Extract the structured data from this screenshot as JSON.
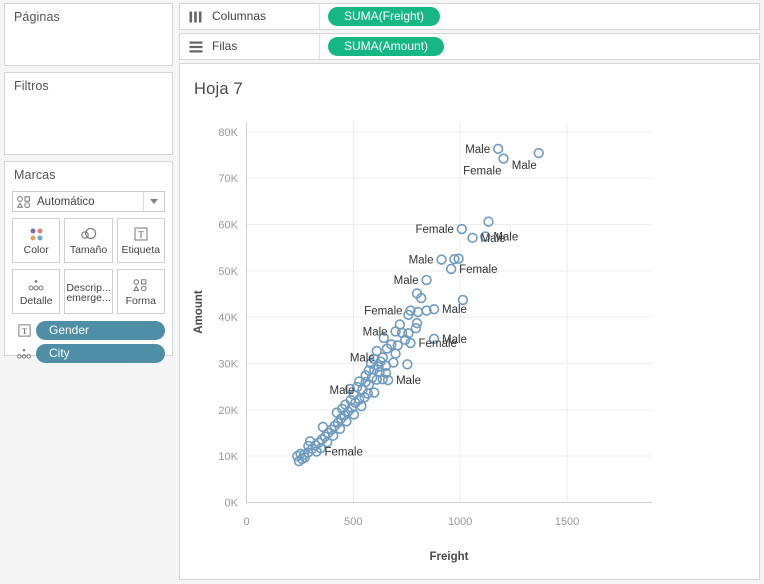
{
  "sidebar": {
    "pages": {
      "title": "Páginas"
    },
    "filters": {
      "title": "Filtros"
    },
    "marks": {
      "title": "Marcas",
      "mark_type": "Automático",
      "buttons": [
        {
          "label": "Color",
          "icon": "color-dots-icon"
        },
        {
          "label": "Tamaño",
          "icon": "size-circles-icon"
        },
        {
          "label": "Etiqueta",
          "icon": "label-t-icon"
        },
        {
          "label": "Detalle",
          "icon": "detail-dots-icon"
        },
        {
          "label": "Descrip... emerge...",
          "label_line1": "Descrip...",
          "label_line2": "emerge...",
          "icon": "tooltip-icon"
        },
        {
          "label": "Forma",
          "icon": "shape-icon"
        }
      ],
      "shelf_pills": [
        {
          "label": "Gender",
          "icon": "label-t-icon"
        },
        {
          "label": "City",
          "icon": "detail-dots-icon"
        }
      ]
    }
  },
  "shelves": [
    {
      "name": "Columnas",
      "icon": "columns-icon",
      "pill": "SUMA(Freight)"
    },
    {
      "name": "Filas",
      "icon": "rows-icon",
      "pill": "SUMA(Amount)"
    }
  ],
  "worksheet": {
    "title": "Hoja 7"
  },
  "colors": {
    "pill_green": "#16b783",
    "pill_blue": "#4e8fa6",
    "mark_stroke": "#6f9bc0",
    "gridline": "#eeeeee",
    "panel_bg": "#f5f5f5"
  },
  "chart_data": {
    "type": "scatter",
    "title": "Hoja 7",
    "xlabel": "Freight",
    "ylabel": "Amount",
    "xlim": [
      0,
      1900
    ],
    "ylim": [
      0,
      82000
    ],
    "xticks": [
      0,
      500,
      1000,
      1500
    ],
    "xticklabels": [
      "0",
      "500",
      "1000",
      "1500"
    ],
    "yticks": [
      0,
      10000,
      20000,
      30000,
      40000,
      50000,
      60000,
      70000,
      80000
    ],
    "yticklabels": [
      "0K",
      "10K",
      "20K",
      "30K",
      "40K",
      "50K",
      "60K",
      "70K",
      "80K"
    ],
    "grid": true,
    "legend": null,
    "marker": "open-circle",
    "label_field": "Gender",
    "detail_field": "City",
    "points": [
      {
        "x": 1180,
        "y": 76200,
        "label": "Male",
        "label_pos": "left"
      },
      {
        "x": 1205,
        "y": 74100,
        "label": "Female",
        "label_pos": "below"
      },
      {
        "x": 1370,
        "y": 75300,
        "label": "Male",
        "label_pos": "below"
      },
      {
        "x": 1135,
        "y": 60500,
        "label": "",
        "label_pos": "none"
      },
      {
        "x": 1010,
        "y": 58900,
        "label": "Female",
        "label_pos": "left"
      },
      {
        "x": 1060,
        "y": 57000,
        "label": "Male",
        "label_pos": "right"
      },
      {
        "x": 1120,
        "y": 57300,
        "label": "Male",
        "label_pos": "right"
      },
      {
        "x": 915,
        "y": 52300,
        "label": "Male",
        "label_pos": "left"
      },
      {
        "x": 975,
        "y": 52400,
        "label": "",
        "label_pos": "none"
      },
      {
        "x": 995,
        "y": 52500,
        "label": "",
        "label_pos": "none"
      },
      {
        "x": 960,
        "y": 50300,
        "label": "Female",
        "label_pos": "right"
      },
      {
        "x": 845,
        "y": 47900,
        "label": "Male",
        "label_pos": "left"
      },
      {
        "x": 800,
        "y": 45000,
        "label": "",
        "label_pos": "none"
      },
      {
        "x": 820,
        "y": 44000,
        "label": "",
        "label_pos": "none"
      },
      {
        "x": 1015,
        "y": 43600,
        "label": "",
        "label_pos": "none"
      },
      {
        "x": 880,
        "y": 41600,
        "label": "Male",
        "label_pos": "right"
      },
      {
        "x": 845,
        "y": 41300,
        "label": "",
        "label_pos": "none"
      },
      {
        "x": 805,
        "y": 41000,
        "label": "",
        "label_pos": "none"
      },
      {
        "x": 770,
        "y": 41300,
        "label": "Female",
        "label_pos": "left"
      },
      {
        "x": 800,
        "y": 38600,
        "label": "",
        "label_pos": "none"
      },
      {
        "x": 795,
        "y": 37500,
        "label": "",
        "label_pos": "none"
      },
      {
        "x": 880,
        "y": 35200,
        "label": "Male",
        "label_pos": "right"
      },
      {
        "x": 700,
        "y": 36800,
        "label": "Male",
        "label_pos": "left"
      },
      {
        "x": 730,
        "y": 36500,
        "label": "",
        "label_pos": "none"
      },
      {
        "x": 760,
        "y": 36400,
        "label": "",
        "label_pos": "none"
      },
      {
        "x": 745,
        "y": 35000,
        "label": "",
        "label_pos": "none"
      },
      {
        "x": 770,
        "y": 34300,
        "label": "Female",
        "label_pos": "right"
      },
      {
        "x": 660,
        "y": 33100,
        "label": "",
        "label_pos": "none"
      },
      {
        "x": 700,
        "y": 32000,
        "label": "",
        "label_pos": "none"
      },
      {
        "x": 755,
        "y": 29700,
        "label": "",
        "label_pos": "none"
      },
      {
        "x": 640,
        "y": 31200,
        "label": "Male",
        "label_pos": "left"
      },
      {
        "x": 600,
        "y": 28600,
        "label": "",
        "label_pos": "none"
      },
      {
        "x": 625,
        "y": 28000,
        "label": "",
        "label_pos": "none"
      },
      {
        "x": 655,
        "y": 27800,
        "label": "",
        "label_pos": "none"
      },
      {
        "x": 665,
        "y": 26300,
        "label": "Male",
        "label_pos": "right"
      },
      {
        "x": 640,
        "y": 26500,
        "label": "",
        "label_pos": "none"
      },
      {
        "x": 612,
        "y": 26400,
        "label": "",
        "label_pos": "none"
      },
      {
        "x": 590,
        "y": 26800,
        "label": "",
        "label_pos": "none"
      },
      {
        "x": 575,
        "y": 25300,
        "label": "",
        "label_pos": "none"
      },
      {
        "x": 560,
        "y": 25900,
        "label": "",
        "label_pos": "none"
      },
      {
        "x": 545,
        "y": 24200,
        "label": "Male",
        "label_pos": "left"
      },
      {
        "x": 570,
        "y": 23400,
        "label": "",
        "label_pos": "none"
      },
      {
        "x": 600,
        "y": 23600,
        "label": "",
        "label_pos": "none"
      },
      {
        "x": 555,
        "y": 22600,
        "label": "",
        "label_pos": "none"
      },
      {
        "x": 530,
        "y": 22100,
        "label": "",
        "label_pos": "none"
      },
      {
        "x": 512,
        "y": 21400,
        "label": "",
        "label_pos": "none"
      },
      {
        "x": 540,
        "y": 20700,
        "label": "",
        "label_pos": "none"
      },
      {
        "x": 495,
        "y": 20300,
        "label": "",
        "label_pos": "none"
      },
      {
        "x": 478,
        "y": 19500,
        "label": "",
        "label_pos": "none"
      },
      {
        "x": 505,
        "y": 18900,
        "label": "",
        "label_pos": "none"
      },
      {
        "x": 460,
        "y": 18700,
        "label": "",
        "label_pos": "none"
      },
      {
        "x": 445,
        "y": 18000,
        "label": "",
        "label_pos": "none"
      },
      {
        "x": 470,
        "y": 17400,
        "label": "",
        "label_pos": "none"
      },
      {
        "x": 430,
        "y": 17100,
        "label": "",
        "label_pos": "none"
      },
      {
        "x": 415,
        "y": 16400,
        "label": "",
        "label_pos": "none"
      },
      {
        "x": 440,
        "y": 15800,
        "label": "",
        "label_pos": "none"
      },
      {
        "x": 400,
        "y": 15600,
        "label": "",
        "label_pos": "none"
      },
      {
        "x": 385,
        "y": 14900,
        "label": "",
        "label_pos": "none"
      },
      {
        "x": 408,
        "y": 14300,
        "label": "",
        "label_pos": "none"
      },
      {
        "x": 370,
        "y": 14100,
        "label": "",
        "label_pos": "none"
      },
      {
        "x": 355,
        "y": 13500,
        "label": "",
        "label_pos": "none"
      },
      {
        "x": 380,
        "y": 12900,
        "label": "",
        "label_pos": "none"
      },
      {
        "x": 340,
        "y": 12800,
        "label": "",
        "label_pos": "none"
      },
      {
        "x": 325,
        "y": 12200,
        "label": "",
        "label_pos": "none"
      },
      {
        "x": 350,
        "y": 11600,
        "label": "",
        "label_pos": "none"
      },
      {
        "x": 310,
        "y": 11500,
        "label": "",
        "label_pos": "none"
      },
      {
        "x": 330,
        "y": 10900,
        "label": "Female",
        "label_pos": "right"
      },
      {
        "x": 290,
        "y": 10700,
        "label": "",
        "label_pos": "none"
      },
      {
        "x": 272,
        "y": 10200,
        "label": "",
        "label_pos": "none"
      },
      {
        "x": 255,
        "y": 10400,
        "label": "",
        "label_pos": "none"
      },
      {
        "x": 240,
        "y": 9900,
        "label": "",
        "label_pos": "none"
      },
      {
        "x": 262,
        "y": 9300,
        "label": "",
        "label_pos": "none"
      },
      {
        "x": 248,
        "y": 8800,
        "label": "",
        "label_pos": "none"
      },
      {
        "x": 275,
        "y": 9600,
        "label": "",
        "label_pos": "none"
      },
      {
        "x": 520,
        "y": 24800,
        "label": "",
        "label_pos": "none"
      },
      {
        "x": 585,
        "y": 29900,
        "label": "",
        "label_pos": "none"
      },
      {
        "x": 630,
        "y": 30300,
        "label": "",
        "label_pos": "none"
      },
      {
        "x": 612,
        "y": 32600,
        "label": "",
        "label_pos": "none"
      },
      {
        "x": 680,
        "y": 34000,
        "label": "",
        "label_pos": "none"
      },
      {
        "x": 710,
        "y": 33800,
        "label": "",
        "label_pos": "none"
      },
      {
        "x": 560,
        "y": 27300,
        "label": "",
        "label_pos": "none"
      },
      {
        "x": 505,
        "y": 23100,
        "label": "",
        "label_pos": "none"
      },
      {
        "x": 490,
        "y": 22000,
        "label": "",
        "label_pos": "none"
      },
      {
        "x": 465,
        "y": 21000,
        "label": "",
        "label_pos": "none"
      },
      {
        "x": 598,
        "y": 30900,
        "label": "",
        "label_pos": "none"
      },
      {
        "x": 645,
        "y": 35400,
        "label": "",
        "label_pos": "none"
      },
      {
        "x": 720,
        "y": 38300,
        "label": "",
        "label_pos": "none"
      },
      {
        "x": 760,
        "y": 40400,
        "label": "",
        "label_pos": "none"
      },
      {
        "x": 690,
        "y": 30100,
        "label": "",
        "label_pos": "none"
      },
      {
        "x": 300,
        "y": 13100,
        "label": "",
        "label_pos": "none"
      },
      {
        "x": 292,
        "y": 12100,
        "label": "",
        "label_pos": "none"
      },
      {
        "x": 360,
        "y": 16200,
        "label": "",
        "label_pos": "none"
      },
      {
        "x": 425,
        "y": 19300,
        "label": "",
        "label_pos": "none"
      },
      {
        "x": 450,
        "y": 20100,
        "label": "",
        "label_pos": "none"
      },
      {
        "x": 575,
        "y": 28400,
        "label": "",
        "label_pos": "none"
      },
      {
        "x": 620,
        "y": 29200,
        "label": "",
        "label_pos": "none"
      },
      {
        "x": 655,
        "y": 29400,
        "label": "",
        "label_pos": "none"
      },
      {
        "x": 530,
        "y": 26000,
        "label": "",
        "label_pos": "none"
      },
      {
        "x": 487,
        "y": 24400,
        "label": "",
        "label_pos": "none"
      }
    ]
  }
}
